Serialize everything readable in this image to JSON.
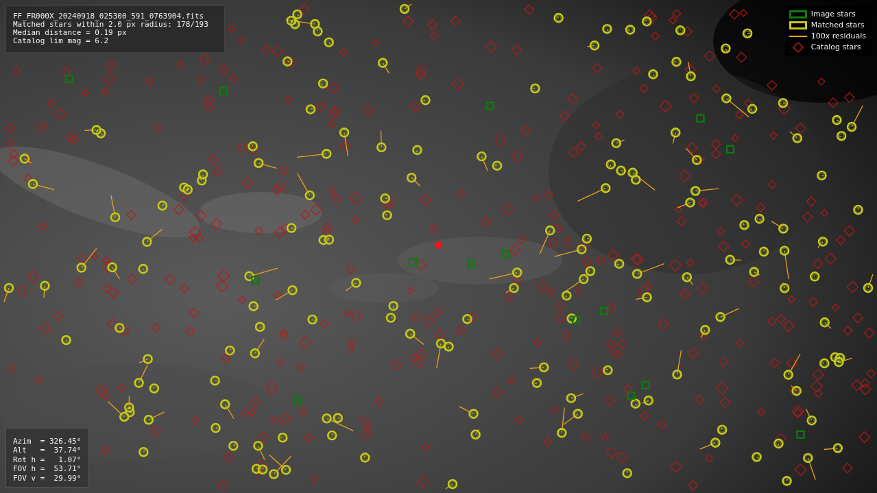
{
  "info": {
    "lines": [
      "FF_FR000X_20240918_025300_591_0763904.fits",
      "Matched stars within 2.0 px radius: 178/193",
      "Median distance = 0.19 px",
      "Catalog lim mag = 6.2"
    ]
  },
  "legend": [
    {
      "kind": "box",
      "label": "Image stars",
      "color": "#0b7d0b"
    },
    {
      "kind": "box",
      "label": "Matched stars",
      "color": "#c9c91c"
    },
    {
      "kind": "line",
      "label": "100x residuals",
      "color": "#f0a020"
    },
    {
      "kind": "diamond",
      "label": "Catalog stars",
      "color": "#c01818"
    }
  ],
  "pointing": {
    "lines": [
      "Azim  = 326.45°",
      "Alt   =  37.74°",
      "Rot h =   1.07°",
      "FOV h =  53.71°",
      "FOV v =  29.99°"
    ]
  }
}
